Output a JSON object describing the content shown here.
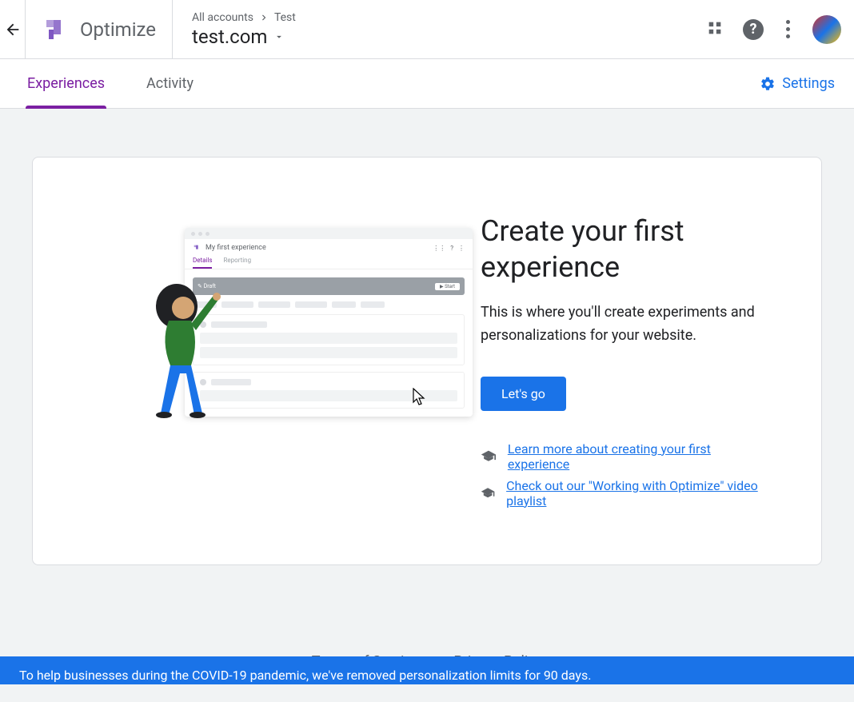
{
  "header": {
    "brand": "Optimize",
    "breadcrumb_root": "All accounts",
    "breadcrumb_leaf": "Test",
    "container_name": "test.com"
  },
  "tabs": {
    "experiences": "Experiences",
    "activity": "Activity",
    "settings": "Settings"
  },
  "card": {
    "title": "Create your first experience",
    "desc": "This is where you'll create experiments and personalizations for your website.",
    "cta": "Let's go",
    "link1": "Learn more about creating your first experience",
    "link2": "Check out our \"Working with Optimize\" video playlist"
  },
  "illustration": {
    "mini_title": "My first experience",
    "mini_tab1": "Details",
    "mini_tab2": "Reporting",
    "mini_draft": "Draft",
    "mini_start": "Start"
  },
  "footer": {
    "tos": "Terms of Service",
    "privacy": "Privacy Policy"
  },
  "banner": {
    "text": "To help businesses during the COVID-19 pandemic, we've removed personalization limits for 90 days."
  }
}
